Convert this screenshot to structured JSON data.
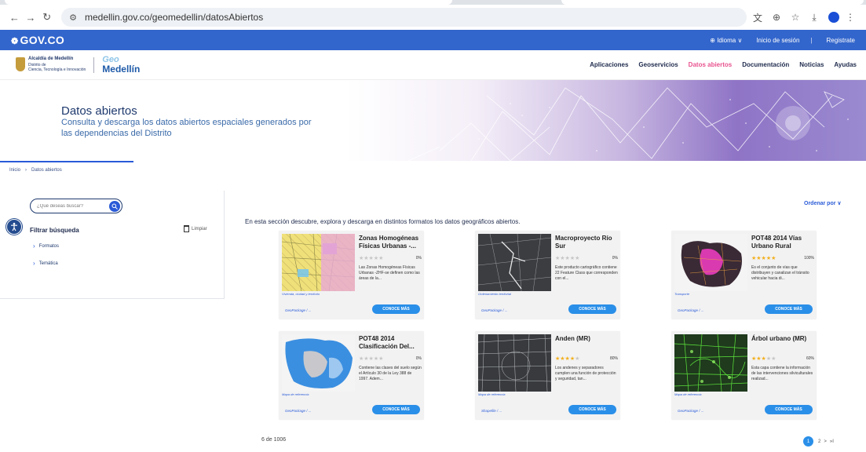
{
  "browser": {
    "url": "medellin.gov.co/geomedellin/datosAbiertos"
  },
  "gov_bar": {
    "logo": "GOV.CO",
    "language": "⊕ Idioma ∨",
    "login": "Inicio de sesión",
    "separator": "|",
    "register": "Registrate"
  },
  "header": {
    "alcaldia_name": "Alcaldía de Medellín",
    "alcaldia_sub1": "Distrito de",
    "alcaldia_sub2": "Ciencia, Tecnología e Innovación",
    "logo_geo": "Geo",
    "logo_city": "Medellín",
    "nav": [
      "Aplicaciones",
      "Geoservicios",
      "Datos abiertos",
      "Documentación",
      "Noticias",
      "Ayudas"
    ]
  },
  "hero": {
    "title": "Datos abiertos",
    "subtitle": "Consulta y descarga los datos abiertos espaciales generados por las dependencias del Distrito"
  },
  "breadcrumb": {
    "home": "Inicio",
    "current": "Datos abiertos"
  },
  "sidebar": {
    "search_placeholder": "¿Qué deseas buscar?",
    "filter_title": "Filtrar búsqueda",
    "clear": "Limpiar",
    "facets": [
      "Formatos",
      "Temática"
    ]
  },
  "content": {
    "sort": "Ordenar por ∨",
    "intro": "En esta sección descubre, explora y descarga en distintos formatos los datos geográficos abiertos.",
    "button_label": "CONOCE MÁS",
    "results": "6 de 1006",
    "pages": [
      "1",
      "2",
      ">",
      "»I"
    ],
    "colors": {
      "accent": "#2a8fe8",
      "gov_blue": "#3366cc",
      "star": "#f2b01e"
    },
    "cards": [
      {
        "title": "Zonas Homogéneas Físicas Urbanas -...",
        "rating": 0,
        "percent": "0%",
        "description": "Las Zonas Homogéneas Físicas Urbanas -ZHF-se definen como las áreas de la...",
        "category": "Vivienda, ciudad y territorio",
        "formats": "GeoPackage / ..."
      },
      {
        "title": "Macroproyecto Río Sur",
        "rating": 0,
        "percent": "0%",
        "description": "Este producto cartográfico contiene 22 Feature Class que corresponden con el...",
        "category": "Ordenamiento territorial",
        "formats": "GeoPackage / ..."
      },
      {
        "title": "POT48 2014 Vías Urbano Rural",
        "rating": 5,
        "percent": "100%",
        "description": "Es el conjunto de vías que distribuyen y canalizan el tránsito vehicular hacia di...",
        "category": "Transporte",
        "formats": "GeoPackage / ..."
      },
      {
        "title": "POT48 2014 Clasificación Del...",
        "rating": 0,
        "percent": "0%",
        "description": "Contiene las clases del suelo según el Artículo 30 de la Ley 388 de 1997. Adem...",
        "category": "Mapa de referencia",
        "formats": "GeoPackage / ..."
      },
      {
        "title": "Anden (MR)",
        "rating": 4,
        "percent": "80%",
        "description": "Los andenes y separadores cumplen una función de protección y seguridad, tan...",
        "category": "Mapa de referencia",
        "formats": "Shapefile / ..."
      },
      {
        "title": "Árbol urbano (MR)",
        "rating": 3,
        "percent": "60%",
        "description": "Esta capa contiene la información de las intervenciones silviculturales realizad...",
        "category": "Mapa de referencia",
        "formats": "GeoPackage / ..."
      }
    ]
  }
}
